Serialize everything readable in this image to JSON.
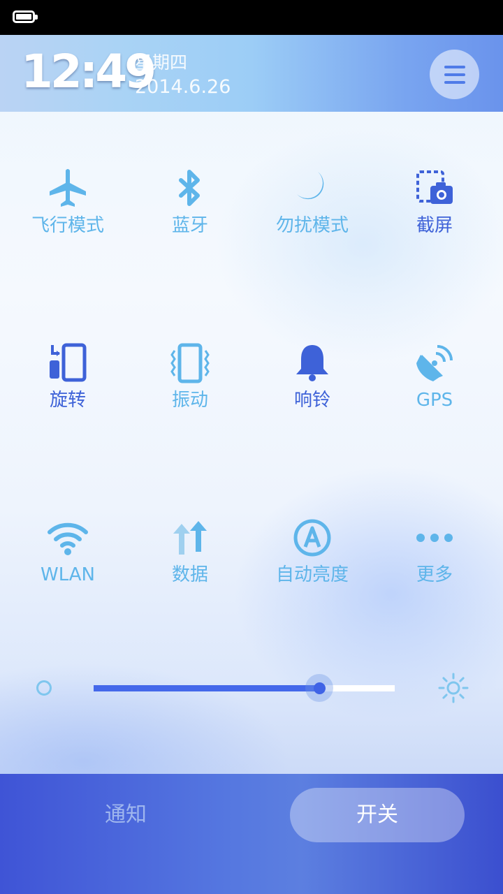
{
  "header": {
    "time": "12:49",
    "weekday": "星期四",
    "date": "2014.6.26"
  },
  "tiles": [
    {
      "label": "飞行模式",
      "icon": "airplane-icon",
      "active": false
    },
    {
      "label": "蓝牙",
      "icon": "bluetooth-icon",
      "active": false
    },
    {
      "label": "勿扰模式",
      "icon": "moon-icon",
      "active": false
    },
    {
      "label": "截屏",
      "icon": "screenshot-icon",
      "active": true
    },
    {
      "label": "旋转",
      "icon": "rotate-icon",
      "active": true
    },
    {
      "label": "振动",
      "icon": "vibrate-icon",
      "active": false
    },
    {
      "label": "响铃",
      "icon": "bell-icon",
      "active": true
    },
    {
      "label": "GPS",
      "icon": "gps-icon",
      "active": false
    },
    {
      "label": "WLAN",
      "icon": "wifi-icon",
      "active": false
    },
    {
      "label": "数据",
      "icon": "data-icon",
      "active": false
    },
    {
      "label": "自动亮度",
      "icon": "auto-brightness-icon",
      "active": false
    },
    {
      "label": "更多",
      "icon": "more-icon",
      "active": false
    }
  ],
  "brightness": {
    "level": 0.75
  },
  "tabs": {
    "notify_label": "通知",
    "switch_label": "开关"
  },
  "colors": {
    "inactive": "#5eb5ea",
    "active": "#3e62d8",
    "accent": "#4468ea"
  }
}
